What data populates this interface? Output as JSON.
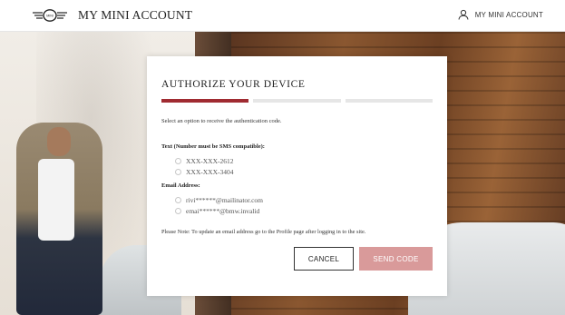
{
  "header": {
    "brand": "MY MINI ACCOUNT",
    "account_label": "MY MINI ACCOUNT",
    "logo_icon": "mini-logo-icon",
    "account_icon": "user-icon"
  },
  "modal": {
    "title": "AUTHORIZE YOUR DEVICE",
    "progress": {
      "current_step": 1,
      "total_steps": 3,
      "active_color": "#a02b31"
    },
    "instruction": "Select an option to receive the authentication code.",
    "text_section": {
      "label": "Text (Number must be SMS compatible):",
      "options": [
        "XXX-XXX-2612",
        "XXX-XXX-3404"
      ]
    },
    "email_section": {
      "label": "Email Address:",
      "options": [
        "rivi******@mailinator.com",
        "emai******@bmw.invalid"
      ]
    },
    "note": "Please Note: To update an email address go to the Profile page after logging in to the site.",
    "cancel_label": "CANCEL",
    "send_label": "SEND CODE",
    "send_color": "#d99a9a"
  }
}
